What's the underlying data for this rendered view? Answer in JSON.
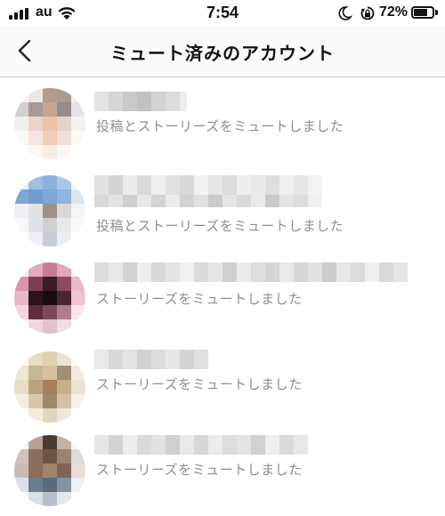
{
  "status_bar": {
    "carrier": "au",
    "time": "7:54",
    "battery_percent": "72%"
  },
  "header": {
    "title": "ミュート済みのアカウント"
  },
  "accounts": [
    {
      "status": "投稿とストーリーズをミュートしました"
    },
    {
      "status": "投稿とストーリーズをミュートしました"
    },
    {
      "status": "ストーリーズをミュートしました"
    },
    {
      "status": "ストーリーズをミュートしました"
    },
    {
      "status": "ストーリーズをミュートしました"
    }
  ],
  "colors": {
    "secondary_text": "#8e8e8e",
    "divider": "#c8c8c8"
  }
}
